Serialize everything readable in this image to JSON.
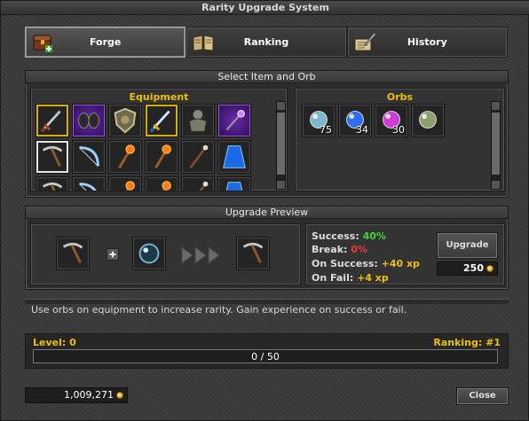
{
  "window": {
    "title": "Rarity Upgrade System"
  },
  "tabs": [
    {
      "label": "Forge",
      "icon": "chest-icon",
      "active": true
    },
    {
      "label": "Ranking",
      "icon": "book-icon",
      "active": false
    },
    {
      "label": "History",
      "icon": "quill-icon",
      "active": false
    }
  ],
  "select_panel": {
    "title": "Select Item and Orb",
    "equipment_title": "Equipment",
    "orbs_title": "Orbs",
    "equipment": [
      {
        "icon": "sword-icon",
        "frame": "gold"
      },
      {
        "icon": "gloves-icon",
        "frame": "rare"
      },
      {
        "icon": "shield-icon",
        "frame": "none"
      },
      {
        "icon": "blue-sword-icon",
        "frame": "gold"
      },
      {
        "icon": "armor-icon",
        "frame": "none"
      },
      {
        "icon": "wand-icon",
        "frame": "rare"
      },
      {
        "icon": "pickaxe-icon",
        "frame": "white"
      },
      {
        "icon": "bow-icon",
        "frame": "none"
      },
      {
        "icon": "fire-staff-icon",
        "frame": "none"
      },
      {
        "icon": "fire-staff-icon",
        "frame": "none"
      },
      {
        "icon": "staff-icon",
        "frame": "none"
      },
      {
        "icon": "cape-icon",
        "frame": "none"
      }
    ],
    "orbs": [
      {
        "icon": "clear-orb-icon",
        "count": "75",
        "color": "#7fb6d0"
      },
      {
        "icon": "blue-orb-icon",
        "count": "34",
        "color": "#2f6ef0"
      },
      {
        "icon": "purple-orb-icon",
        "count": "30",
        "color": "#d03ad8"
      },
      {
        "icon": "green-orb-icon",
        "count": "",
        "color": "#8fa070"
      }
    ]
  },
  "preview_panel": {
    "title": "Upgrade Preview",
    "success_label": "Success:",
    "success_value": "40%",
    "break_label": "Break:",
    "break_value": "0%",
    "on_success_label": "On Success:",
    "on_success_value": "+40 xp",
    "on_fail_label": "On Fail:",
    "on_fail_value": "+4 xp",
    "upgrade_button": "Upgrade",
    "cost": "250",
    "colors": {
      "success": "#3ed43e",
      "break": "#e83a3a",
      "xp": "#f0c000"
    }
  },
  "hint_text": "Use orbs on equipment to increase rarity. Gain experience on success or fail.",
  "level": {
    "level_text": "Level: 0",
    "ranking_text": "Ranking: #1",
    "progress_text": "0 / 50",
    "progress_fraction": 0
  },
  "footer": {
    "gold": "1,009,271",
    "close_button": "Close"
  }
}
